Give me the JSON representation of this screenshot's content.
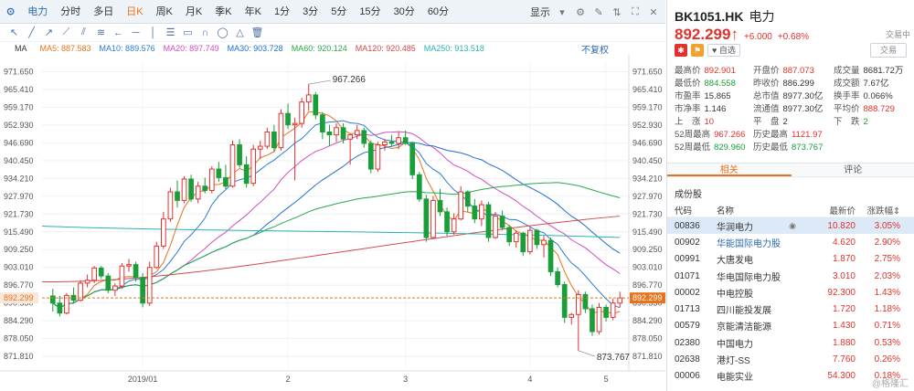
{
  "tabs": {
    "logo": "⊙",
    "items": [
      "电力",
      "分时",
      "多日",
      "日K",
      "周K",
      "月K",
      "季K",
      "年K",
      "1分",
      "3分",
      "5分",
      "15分",
      "30分",
      "60分"
    ],
    "active_index": 3,
    "display_label": "显示"
  },
  "ma": {
    "label": "MA",
    "items": [
      {
        "text": "MA5: 887.583",
        "color": "#e8731a"
      },
      {
        "text": "MA10: 889.576",
        "color": "#2b7bd6"
      },
      {
        "text": "MA20: 897.749",
        "color": "#d04ec0"
      },
      {
        "text": "MA30: 903.728",
        "color": "#1f6fd0"
      },
      {
        "text": "MA60: 920.124",
        "color": "#2aa84a"
      },
      {
        "text": "MA120: 920.485",
        "color": "#d24a4a"
      },
      {
        "text": "MA250: 913.518",
        "color": "#2bb3b3"
      }
    ],
    "fq_label": "不复权"
  },
  "chart_data": {
    "type": "candlestick",
    "y_ticks": [
      "971.650",
      "965.410",
      "959.170",
      "952.930",
      "946.690",
      "940.450",
      "934.210",
      "927.970",
      "921.730",
      "915.490",
      "909.250",
      "903.010",
      "896.770",
      "890.530",
      "884.290",
      "878.050",
      "871.810"
    ],
    "y_ticks_right": [
      "971.650",
      "965.410",
      "959.170",
      "952.930",
      "946.690",
      "940.450",
      "934.210",
      "927.970",
      "921.730",
      "915.490",
      "909.250",
      "903.010",
      "896.770",
      "890.530",
      "884.290",
      "878.050",
      "871.810"
    ],
    "ylim": [
      868.0,
      975.0
    ],
    "x_labels": [
      "2019/01",
      "2",
      "3",
      "4",
      "5"
    ],
    "current_price": "892.299",
    "high_annotation": "967.266",
    "low_annotation": "873.767",
    "candles": [
      [
        893.0,
        895.5,
        887.5,
        890.5
      ],
      [
        890.5,
        893.0,
        885.8,
        887.0
      ],
      [
        887.0,
        894.0,
        886.5,
        893.2
      ],
      [
        893.2,
        896.0,
        890.5,
        891.5
      ],
      [
        891.5,
        898.5,
        891.0,
        897.5
      ],
      [
        897.5,
        900.5,
        896.0,
        898.5
      ],
      [
        898.5,
        903.5,
        897.5,
        902.8
      ],
      [
        902.8,
        903.5,
        899.0,
        900.0
      ],
      [
        900.0,
        901.0,
        894.0,
        895.0
      ],
      [
        895.0,
        897.5,
        893.0,
        896.5
      ],
      [
        896.5,
        904.5,
        895.5,
        903.5
      ],
      [
        903.5,
        906.0,
        901.5,
        904.0
      ],
      [
        904.0,
        905.0,
        898.0,
        899.5
      ],
      [
        899.5,
        901.0,
        889.0,
        890.5
      ],
      [
        890.5,
        905.0,
        889.5,
        903.0
      ],
      [
        903.0,
        912.0,
        902.5,
        910.5
      ],
      [
        910.5,
        922.5,
        909.5,
        920.0
      ],
      [
        920.0,
        931.0,
        919.0,
        929.5
      ],
      [
        929.5,
        933.5,
        924.0,
        926.5
      ],
      [
        926.5,
        935.0,
        925.5,
        934.0
      ],
      [
        934.0,
        935.5,
        926.0,
        927.0
      ],
      [
        927.0,
        933.0,
        925.5,
        931.5
      ],
      [
        931.5,
        934.5,
        929.0,
        930.0
      ],
      [
        930.0,
        938.5,
        929.0,
        937.5
      ],
      [
        937.5,
        940.0,
        933.0,
        934.5
      ],
      [
        934.5,
        939.0,
        930.5,
        931.5
      ],
      [
        931.5,
        947.5,
        931.0,
        946.0
      ],
      [
        946.0,
        948.0,
        938.0,
        939.0
      ],
      [
        939.0,
        942.0,
        931.0,
        932.5
      ],
      [
        932.5,
        946.0,
        931.5,
        944.5
      ],
      [
        944.5,
        947.5,
        941.0,
        945.5
      ],
      [
        945.5,
        952.0,
        944.5,
        950.5
      ],
      [
        950.5,
        953.0,
        943.5,
        945.0
      ],
      [
        945.0,
        958.5,
        944.0,
        957.0
      ],
      [
        957.0,
        960.5,
        951.5,
        953.0
      ],
      [
        953.0,
        955.5,
        933.5,
        953.5
      ],
      [
        953.5,
        962.5,
        952.0,
        961.0
      ],
      [
        961.0,
        967.3,
        958.0,
        963.5
      ],
      [
        963.5,
        964.5,
        955.0,
        956.5
      ],
      [
        956.5,
        957.5,
        948.0,
        950.5
      ],
      [
        950.5,
        953.0,
        945.5,
        949.5
      ],
      [
        949.5,
        953.5,
        947.0,
        952.0
      ],
      [
        952.0,
        953.5,
        946.5,
        948.0
      ],
      [
        948.0,
        950.0,
        939.0,
        949.5
      ],
      [
        949.5,
        953.0,
        948.0,
        951.0
      ],
      [
        951.0,
        952.0,
        945.0,
        946.5
      ],
      [
        946.5,
        947.5,
        936.0,
        937.5
      ],
      [
        937.5,
        947.0,
        936.5,
        946.0
      ],
      [
        946.0,
        948.0,
        944.0,
        947.0
      ],
      [
        947.0,
        949.5,
        945.5,
        946.5
      ],
      [
        946.5,
        950.5,
        944.5,
        948.5
      ],
      [
        948.5,
        951.0,
        946.0,
        946.5
      ],
      [
        946.5,
        947.0,
        934.0,
        935.5
      ],
      [
        935.5,
        936.5,
        926.0,
        927.0
      ],
      [
        927.0,
        928.5,
        912.0,
        913.5
      ],
      [
        913.5,
        928.0,
        913.0,
        926.5
      ],
      [
        926.5,
        930.5,
        921.0,
        922.5
      ],
      [
        922.5,
        924.0,
        914.0,
        915.5
      ],
      [
        915.5,
        922.0,
        914.5,
        920.0
      ],
      [
        920.0,
        931.5,
        919.5,
        929.5
      ],
      [
        929.5,
        930.0,
        922.5,
        924.5
      ],
      [
        924.5,
        927.0,
        918.5,
        920.0
      ],
      [
        920.0,
        926.5,
        917.5,
        925.0
      ],
      [
        925.0,
        926.0,
        912.0,
        913.5
      ],
      [
        913.5,
        922.5,
        913.0,
        921.0
      ],
      [
        921.0,
        923.0,
        916.0,
        917.0
      ],
      [
        917.0,
        918.0,
        910.5,
        912.0
      ],
      [
        912.0,
        916.0,
        910.0,
        915.0
      ],
      [
        915.0,
        915.5,
        907.0,
        908.5
      ],
      [
        908.5,
        917.0,
        907.5,
        916.0
      ],
      [
        916.0,
        916.5,
        909.5,
        911.0
      ],
      [
        911.0,
        914.0,
        906.5,
        912.5
      ],
      [
        912.5,
        913.5,
        900.0,
        901.5
      ],
      [
        901.5,
        903.0,
        896.0,
        897.0
      ],
      [
        897.0,
        898.0,
        883.5,
        885.5
      ],
      [
        885.5,
        887.0,
        883.0,
        886.5
      ],
      [
        886.5,
        895.0,
        873.8,
        893.5
      ],
      [
        893.5,
        894.5,
        887.0,
        888.5
      ],
      [
        888.5,
        890.0,
        879.0,
        880.5
      ],
      [
        880.5,
        890.5,
        879.5,
        889.0
      ],
      [
        889.0,
        890.0,
        884.0,
        885.5
      ],
      [
        885.5,
        892.0,
        884.5,
        890.5
      ],
      [
        890.5,
        894.5,
        889.0,
        892.3
      ]
    ]
  },
  "stock": {
    "code": "BK1051.HK",
    "name": "电力",
    "price": "892.299",
    "arrow": "↑",
    "change": "+6.000",
    "change_pct": "+0.68%",
    "status": "交易中",
    "watch_label": "自选",
    "trade_label": "交易"
  },
  "stats": [
    [
      {
        "l": "最高价",
        "v": "892.901",
        "c": "red"
      },
      {
        "l": "开盘价",
        "v": "887.073",
        "c": "red"
      },
      {
        "l": "成交量",
        "v": "8681.72万",
        "c": "dark"
      }
    ],
    [
      {
        "l": "最低价",
        "v": "884.558",
        "c": "green"
      },
      {
        "l": "昨收价",
        "v": "886.299",
        "c": "dark"
      },
      {
        "l": "成交额",
        "v": "7.67亿",
        "c": "dark"
      }
    ],
    [
      {
        "l": "市盈率",
        "v": "15.865",
        "c": "dark"
      },
      {
        "l": "总市值",
        "v": "8977.30亿",
        "c": "dark"
      },
      {
        "l": "换手率",
        "v": "0.066%",
        "c": "dark"
      }
    ],
    [
      {
        "l": "市净率",
        "v": "1.146",
        "c": "dark"
      },
      {
        "l": "流通值",
        "v": "8977.30亿",
        "c": "dark"
      },
      {
        "l": "平均价",
        "v": "888.729",
        "c": "red"
      }
    ],
    [
      {
        "l": "上　涨",
        "v": "10",
        "c": "red"
      },
      {
        "l": "平　盘",
        "v": "2",
        "c": "dark"
      },
      {
        "l": "下　跌",
        "v": "2",
        "c": "green"
      }
    ],
    [
      {
        "l": "52周最高",
        "v": "967.266",
        "c": "red"
      },
      {
        "l": "历史最高",
        "v": "1121.97",
        "c": "red"
      },
      {
        "l": "",
        "v": "",
        "c": "dark"
      }
    ],
    [
      {
        "l": "52周最低",
        "v": "829.960",
        "c": "green"
      },
      {
        "l": "历史最低",
        "v": "873.767",
        "c": "green"
      },
      {
        "l": "",
        "v": "",
        "c": "dark"
      }
    ]
  ],
  "rtabs": [
    "相关",
    "评论"
  ],
  "section_title": "成份股",
  "table": {
    "headers": [
      "代码",
      "名称",
      "最新价",
      "涨跌幅"
    ],
    "sort_arrow": "⇕",
    "rows": [
      {
        "code": "00836",
        "name": "华润电力",
        "price": "10.820",
        "pct": "3.05%"
      },
      {
        "code": "00902",
        "name": "华能国际电力股",
        "price": "4.620",
        "pct": "2.90%"
      },
      {
        "code": "00991",
        "name": "大唐发电",
        "price": "1.870",
        "pct": "2.75%"
      },
      {
        "code": "01071",
        "name": "华电国际电力股",
        "price": "3.010",
        "pct": "2.03%"
      },
      {
        "code": "00002",
        "name": "中电控股",
        "price": "92.300",
        "pct": "1.43%"
      },
      {
        "code": "01713",
        "name": "四川能投发展",
        "price": "1.720",
        "pct": "1.18%"
      },
      {
        "code": "00579",
        "name": "京能清洁能源",
        "price": "1.430",
        "pct": "0.71%"
      },
      {
        "code": "02380",
        "name": "中国电力",
        "price": "1.880",
        "pct": "0.53%"
      },
      {
        "code": "02638",
        "name": "港灯-SS",
        "price": "7.760",
        "pct": "0.26%"
      },
      {
        "code": "00006",
        "name": "电能实业",
        "price": "54.300",
        "pct": "0.18%"
      }
    ]
  },
  "watermark": "@格隆汇"
}
